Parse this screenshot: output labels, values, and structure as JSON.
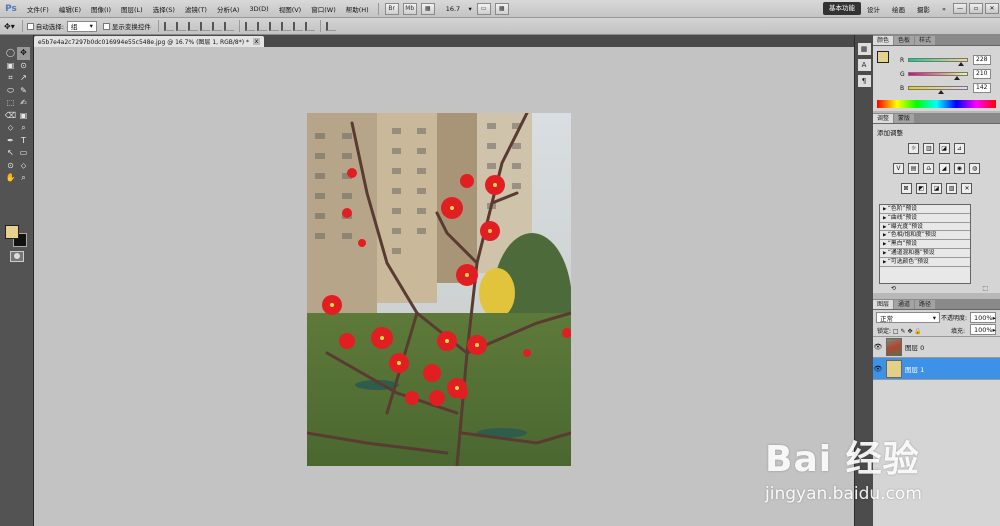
{
  "app": {
    "logo": "Ps"
  },
  "menu": [
    "文件(F)",
    "编辑(E)",
    "图像(I)",
    "图层(L)",
    "选择(S)",
    "滤镜(T)",
    "分析(A)",
    "3D(D)",
    "视图(V)",
    "窗口(W)",
    "帮助(H)"
  ],
  "toolbar_icons": [
    "Br",
    "Mb",
    "▦",
    "▭"
  ],
  "zoom": "16.7",
  "workspaces": [
    "基本功能",
    "设计",
    "绘画",
    "摄影"
  ],
  "active_workspace": "基本功能",
  "more_ws": "»",
  "window_buttons": [
    "—",
    "▫",
    "✕"
  ],
  "options": {
    "auto_select_label": "自动选择:",
    "auto_select_value": "组",
    "show_transform_label": "显示变换控件"
  },
  "document_tab": {
    "title": "e5b7e4a2c7297b0dc016994e55c548e.jpg @ 16.7% (图层 1, RGB/8*) *",
    "close": "x"
  },
  "tools": [
    "↖",
    "✥",
    "◯",
    "⌗",
    "✂",
    "⚲",
    "✎",
    "⬚",
    "⌫",
    "✒",
    "▣",
    "⬭",
    "⬦",
    "⊙",
    "T",
    "↗",
    "✍",
    "▭",
    "✋",
    "⌕"
  ],
  "right_strip_icons": [
    "▦",
    "A",
    "¶"
  ],
  "color_panel": {
    "tabs": [
      "颜色",
      "色板",
      "样式"
    ],
    "fg_color": "#e4d28e",
    "channels": [
      {
        "name": "R",
        "value": "228",
        "fraction": 0.894
      },
      {
        "name": "G",
        "value": "210",
        "fraction": 0.824
      },
      {
        "name": "B",
        "value": "142",
        "fraction": 0.557
      }
    ]
  },
  "adjustments": {
    "tabs": [
      "调整",
      "蒙版"
    ],
    "title": "添加调整",
    "row1": [
      "☼",
      "▥",
      "◪",
      "⊿"
    ],
    "row2": [
      "V",
      "▤",
      "♎",
      "◢",
      "◉",
      "◍"
    ],
    "row3": [
      "⊠",
      "◩",
      "◪",
      "▧",
      "✕"
    ],
    "presets": [
      "“色阶”预设",
      "“曲线”预设",
      "“曝光度”预设",
      "“色相/饱和度”预设",
      "“黑白”预设",
      "“通道混和器”预设",
      "“可选颜色”预设"
    ],
    "footer_left": "⟲",
    "footer_right": "⬚"
  },
  "layers": {
    "tabs": [
      "图层",
      "通道",
      "路径"
    ],
    "blend_mode": "正常",
    "opacity_label": "不透明度:",
    "opacity": "100%",
    "lock_label": "锁定: □ ✎ ✥ 🔒",
    "fill_label": "填充:",
    "fill": "100%",
    "items": [
      {
        "name": "图层 0",
        "selected": false,
        "eye": "👁"
      },
      {
        "name": "图层 1",
        "selected": true,
        "eye": "👁"
      }
    ]
  },
  "watermark": {
    "main": "Bai 经验",
    "sub": "jingyan.baidu.com"
  }
}
